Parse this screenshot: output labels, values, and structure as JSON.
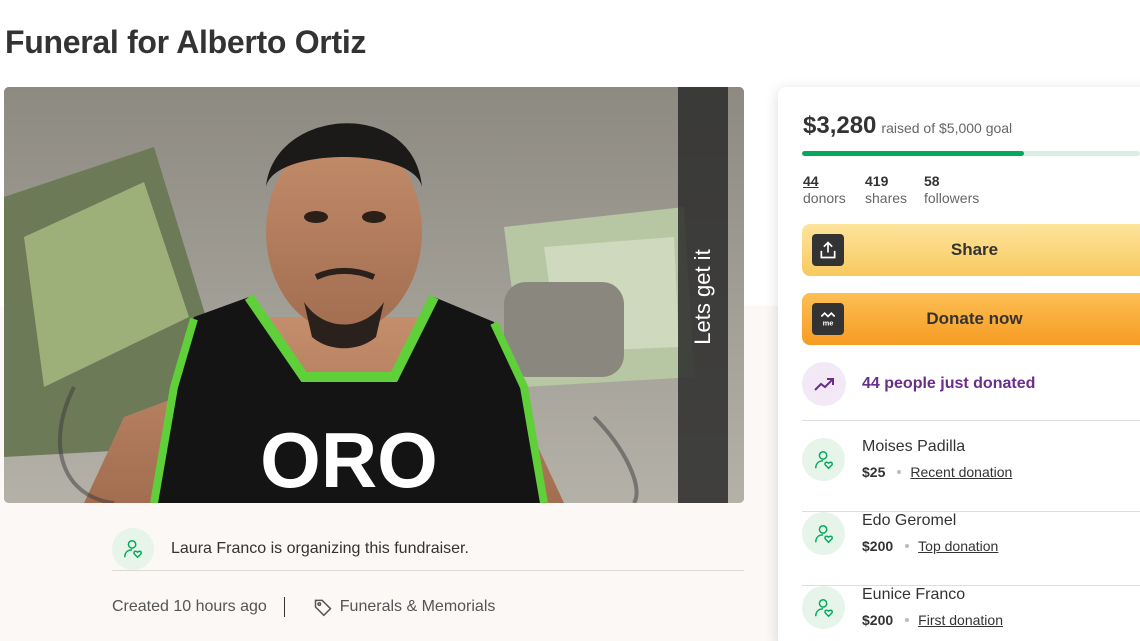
{
  "page": {
    "title": "Funeral for Alberto Ortiz"
  },
  "photo": {
    "overlay_caption": "Lets get it",
    "shirt_text": "ORO"
  },
  "organizer": {
    "text": "Laura Franco is organizing this fundraiser.",
    "icon": "user-heart-icon"
  },
  "meta": {
    "created": "Created 10 hours ago",
    "category": "Funerals & Memorials",
    "category_icon": "tag-icon"
  },
  "progress": {
    "raised": "$3,280",
    "goal_text": "raised of $5,000 goal",
    "fraction": 0.656,
    "color": "#02a95c"
  },
  "stats": [
    {
      "value": "44",
      "label": "donors"
    },
    {
      "value": "419",
      "label": "shares"
    },
    {
      "value": "58",
      "label": "followers"
    }
  ],
  "buttons": {
    "share_label": "Share",
    "share_icon": "upload-icon",
    "donate_label": "Donate now",
    "donate_icon": "gofundme-icon"
  },
  "trend": {
    "text": "44 people just donated",
    "icon": "trending-up-icon",
    "color": "#6b2d8a"
  },
  "donations": [
    {
      "name": "Moises Padilla",
      "amount": "$25",
      "label": "Recent donation"
    },
    {
      "name": "Edo Geromel",
      "amount": "$200",
      "label": "Top donation"
    },
    {
      "name": "Eunice Franco",
      "amount": "$200",
      "label": "First donation"
    }
  ]
}
